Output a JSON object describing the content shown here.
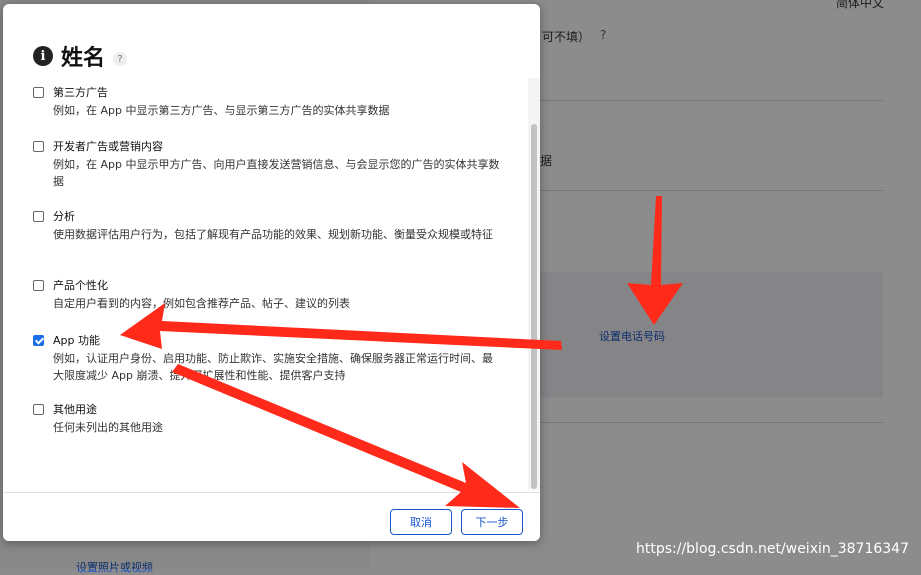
{
  "background": {
    "top_right_text": "简体中文",
    "optional_hint": "可不填）",
    "help_mark": "?",
    "fragment": "据",
    "phone_link": "设置电话号码",
    "bottom_link": "设置照片或视频"
  },
  "modal": {
    "title": "姓名",
    "help": "?",
    "items": [
      {
        "label": "第三方广告",
        "desc": "例如，在 App 中显示第三方广告、与显示第三方广告的实体共享数据",
        "checked": false
      },
      {
        "label": "开发者广告或营销内容",
        "desc": "例如，在 App 中显示甲方广告、向用户直接发送营销信息、与会显示您的广告的实体共享数据",
        "checked": false
      },
      {
        "label": "分析",
        "desc": "使用数据评估用户行为，包括了解现有产品功能的效果、规划新功能、衡量受众规模或特征",
        "checked": false
      },
      {
        "label": "产品个性化",
        "desc": "自定用户看到的内容，例如包含推荐产品、帖子、建议的列表",
        "checked": false
      },
      {
        "label": "App 功能",
        "desc": "例如，认证用户身份、启用功能、防止欺诈、实施安全措施、确保服务器正常运行时间、最大限度减少 App 崩溃、提升可扩展性和性能、提供客户支持",
        "checked": true
      },
      {
        "label": "其他用途",
        "desc": "任何未列出的其他用途",
        "checked": false
      }
    ],
    "cancel_label": "取消",
    "next_label": "下一步"
  },
  "watermark": "https://blog.csdn.net/weixin_38716347",
  "colors": {
    "accent": "#1a55c7",
    "checkbox": "#1a6ee8",
    "arrow": "#ff2a1a"
  }
}
